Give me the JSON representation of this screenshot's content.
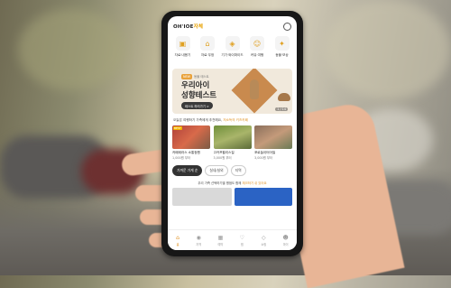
{
  "app": {
    "logo_main": "OH'IOE",
    "logo_accent": "자체"
  },
  "categories": [
    {
      "label": "자료·내용기",
      "icon": "box-icon"
    },
    {
      "label": "자료·우정",
      "icon": "house-icon"
    },
    {
      "label": "기기·와이파이드",
      "icon": "router-icon"
    },
    {
      "label": "커뮤·여행",
      "icon": "people-icon"
    },
    {
      "label": "동물·보상",
      "icon": "gift-icon"
    }
  ],
  "banner": {
    "tag": "NEW",
    "subtitle": "동물 테스트",
    "title_line1": "우리아이",
    "title_line2": "성향테스트",
    "button": "테스트 하러가기 >",
    "page": "1 / 14"
  },
  "section1": {
    "title_prefix": "오늘은 여행하기 가족에게 추천해요, ",
    "title_highlight": "저소득의 키즈카페"
  },
  "cards": [
    {
      "caption": "카페테라스 소통정원",
      "price": "1,000원 부터",
      "badge": "BEST"
    },
    {
      "caption": "고카프윌리스킬",
      "price": "3,000원 부터",
      "badge": ""
    },
    {
      "caption": "포로놀이터어질",
      "price": "3,000원 부터",
      "badge": ""
    }
  ],
  "chips": [
    "가까운 가게 순",
    "실내/실외",
    "지역"
  ],
  "section2": {
    "prefix": "우리 가족 선택하기별 평점도 함께 ",
    "highlight": "체크하기 쉬 있어요"
  },
  "tabs": [
    {
      "label": "홈",
      "icon": "home-icon",
      "active": true
    },
    {
      "label": "지역",
      "icon": "pin-icon",
      "active": false
    },
    {
      "label": "예약",
      "icon": "calendar-icon",
      "active": false
    },
    {
      "label": "찜",
      "icon": "heart-icon",
      "active": false
    },
    {
      "label": "쇼핑",
      "icon": "bag-icon",
      "active": false
    },
    {
      "label": "마이",
      "icon": "person-icon",
      "active": false
    }
  ]
}
